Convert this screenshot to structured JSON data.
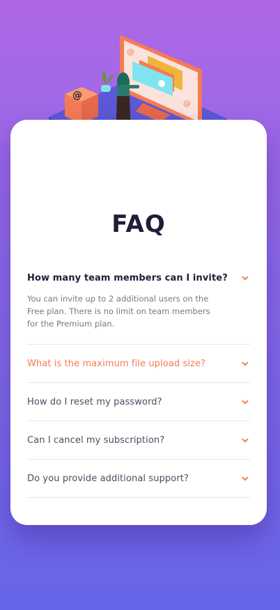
{
  "colors": {
    "accent": "#f47b56",
    "heading": "#1e1f36",
    "text": "#4b4c5f",
    "muted": "#787887",
    "divider": "#e7e7e9",
    "bg_top": "#ae67e6",
    "bg_bottom": "#6565e7"
  },
  "faq": {
    "title": "FAQ",
    "items": [
      {
        "question": "How many team members can I invite?",
        "answer": "You can invite up to 2 additional users on the Free plan. There is no limit on team members for the Premium plan.",
        "expanded": true,
        "icon": "chevron-down-icon"
      },
      {
        "question": "What is the maximum file upload size?",
        "expanded": false,
        "highlighted": true,
        "icon": "chevron-down-icon"
      },
      {
        "question": "How do I reset my password?",
        "expanded": false,
        "icon": "chevron-down-icon"
      },
      {
        "question": "Can I cancel my subscription?",
        "expanded": false,
        "icon": "chevron-down-icon"
      },
      {
        "question": "Do you provide additional support?",
        "expanded": false,
        "icon": "chevron-down-icon"
      }
    ]
  }
}
